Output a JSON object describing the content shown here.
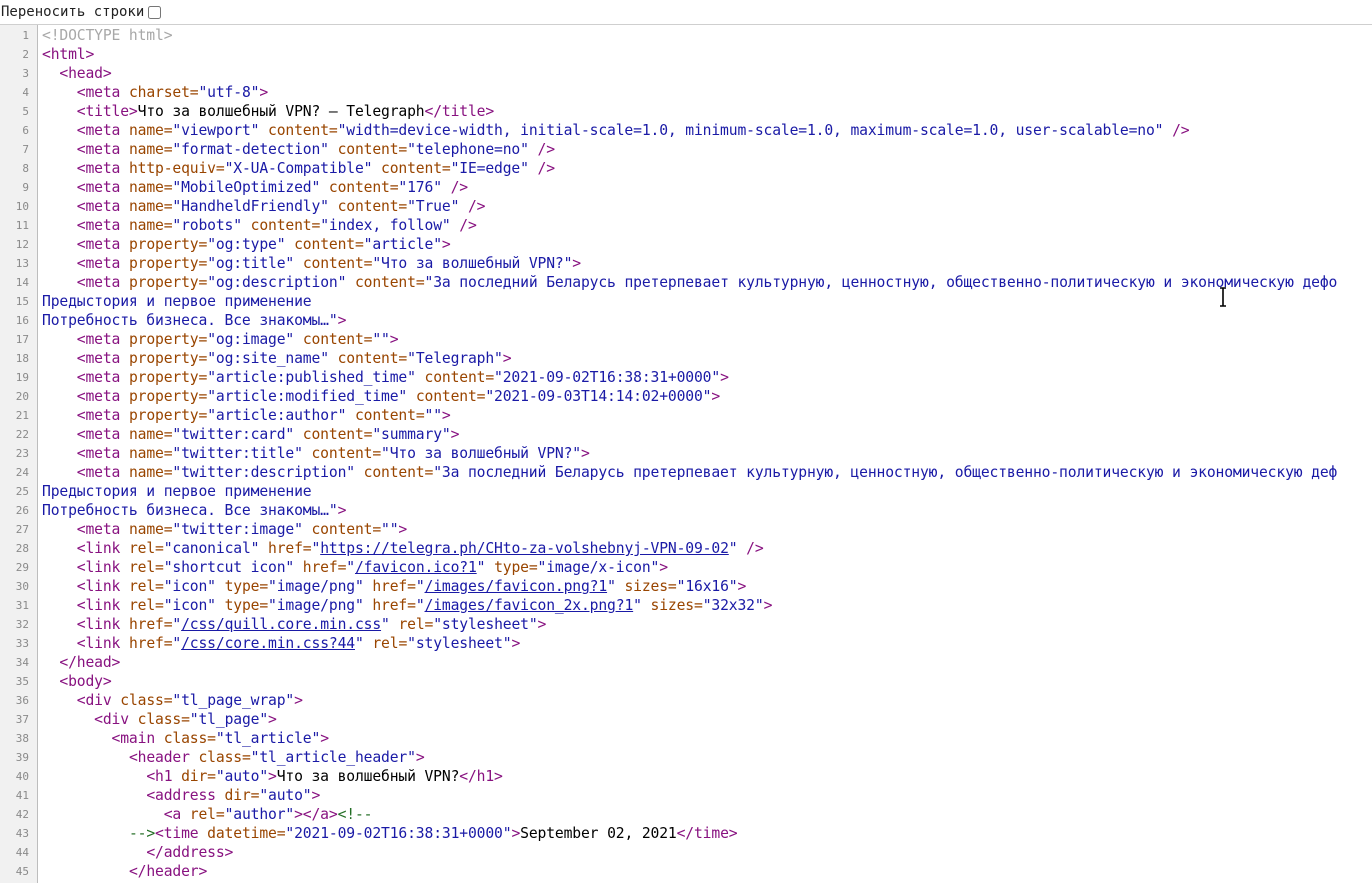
{
  "toolbar": {
    "wrap_label": "Переносить строки",
    "wrap_checked": false
  },
  "lines": [
    [
      [
        "d",
        "<!DOCTYPE html>"
      ]
    ],
    [
      [
        "t",
        "<html>"
      ]
    ],
    [
      [
        "x",
        "  "
      ],
      [
        "t",
        "<head>"
      ]
    ],
    [
      [
        "x",
        "    "
      ],
      [
        "t",
        "<meta"
      ],
      [
        "a",
        " charset="
      ],
      [
        "v",
        "\"utf-8\""
      ],
      [
        "t",
        ">"
      ]
    ],
    [
      [
        "x",
        "    "
      ],
      [
        "t",
        "<title>"
      ],
      [
        "x",
        "Что за волшебный VPN? – Telegraph"
      ],
      [
        "t",
        "</title>"
      ]
    ],
    [
      [
        "x",
        "    "
      ],
      [
        "t",
        "<meta"
      ],
      [
        "a",
        " name="
      ],
      [
        "v",
        "\"viewport\""
      ],
      [
        "a",
        " content="
      ],
      [
        "v",
        "\"width=device-width, initial-scale=1.0, minimum-scale=1.0, maximum-scale=1.0, user-scalable=no\""
      ],
      [
        "t",
        " />"
      ]
    ],
    [
      [
        "x",
        "    "
      ],
      [
        "t",
        "<meta"
      ],
      [
        "a",
        " name="
      ],
      [
        "v",
        "\"format-detection\""
      ],
      [
        "a",
        " content="
      ],
      [
        "v",
        "\"telephone=no\""
      ],
      [
        "t",
        " />"
      ]
    ],
    [
      [
        "x",
        "    "
      ],
      [
        "t",
        "<meta"
      ],
      [
        "a",
        " http-equiv="
      ],
      [
        "v",
        "\"X-UA-Compatible\""
      ],
      [
        "a",
        " content="
      ],
      [
        "v",
        "\"IE=edge\""
      ],
      [
        "t",
        " />"
      ]
    ],
    [
      [
        "x",
        "    "
      ],
      [
        "t",
        "<meta"
      ],
      [
        "a",
        " name="
      ],
      [
        "v",
        "\"MobileOptimized\""
      ],
      [
        "a",
        " content="
      ],
      [
        "v",
        "\"176\""
      ],
      [
        "t",
        " />"
      ]
    ],
    [
      [
        "x",
        "    "
      ],
      [
        "t",
        "<meta"
      ],
      [
        "a",
        " name="
      ],
      [
        "v",
        "\"HandheldFriendly\""
      ],
      [
        "a",
        " content="
      ],
      [
        "v",
        "\"True\""
      ],
      [
        "t",
        " />"
      ]
    ],
    [
      [
        "x",
        "    "
      ],
      [
        "t",
        "<meta"
      ],
      [
        "a",
        " name="
      ],
      [
        "v",
        "\"robots\""
      ],
      [
        "a",
        " content="
      ],
      [
        "v",
        "\"index, follow\""
      ],
      [
        "t",
        " />"
      ]
    ],
    [
      [
        "x",
        "    "
      ],
      [
        "t",
        "<meta"
      ],
      [
        "a",
        " property="
      ],
      [
        "v",
        "\"og:type\""
      ],
      [
        "a",
        " content="
      ],
      [
        "v",
        "\"article\""
      ],
      [
        "t",
        ">"
      ]
    ],
    [
      [
        "x",
        "    "
      ],
      [
        "t",
        "<meta"
      ],
      [
        "a",
        " property="
      ],
      [
        "v",
        "\"og:title\""
      ],
      [
        "a",
        " content="
      ],
      [
        "v",
        "\"Что за волшебный VPN?\""
      ],
      [
        "t",
        ">"
      ]
    ],
    [
      [
        "x",
        "    "
      ],
      [
        "t",
        "<meta"
      ],
      [
        "a",
        " property="
      ],
      [
        "v",
        "\"og:description\""
      ],
      [
        "a",
        " content="
      ],
      [
        "v",
        "\"За последний Беларусь претерпевает культурную, ценностную, общественно-политическую и экономическую дефо"
      ]
    ],
    [
      [
        "v",
        "Предыстория и первое применение"
      ]
    ],
    [
      [
        "v",
        "Потребность бизнеса. Все знакомы…\""
      ],
      [
        "t",
        ">"
      ]
    ],
    [
      [
        "x",
        "    "
      ],
      [
        "t",
        "<meta"
      ],
      [
        "a",
        " property="
      ],
      [
        "v",
        "\"og:image\""
      ],
      [
        "a",
        " content="
      ],
      [
        "v",
        "\"\""
      ],
      [
        "t",
        ">"
      ]
    ],
    [
      [
        "x",
        "    "
      ],
      [
        "t",
        "<meta"
      ],
      [
        "a",
        " property="
      ],
      [
        "v",
        "\"og:site_name\""
      ],
      [
        "a",
        " content="
      ],
      [
        "v",
        "\"Telegraph\""
      ],
      [
        "t",
        ">"
      ]
    ],
    [
      [
        "x",
        "    "
      ],
      [
        "t",
        "<meta"
      ],
      [
        "a",
        " property="
      ],
      [
        "v",
        "\"article:published_time\""
      ],
      [
        "a",
        " content="
      ],
      [
        "v",
        "\"2021-09-02T16:38:31+0000\""
      ],
      [
        "t",
        ">"
      ]
    ],
    [
      [
        "x",
        "    "
      ],
      [
        "t",
        "<meta"
      ],
      [
        "a",
        " property="
      ],
      [
        "v",
        "\"article:modified_time\""
      ],
      [
        "a",
        " content="
      ],
      [
        "v",
        "\"2021-09-03T14:14:02+0000\""
      ],
      [
        "t",
        ">"
      ]
    ],
    [
      [
        "x",
        "    "
      ],
      [
        "t",
        "<meta"
      ],
      [
        "a",
        " property="
      ],
      [
        "v",
        "\"article:author\""
      ],
      [
        "a",
        " content="
      ],
      [
        "v",
        "\"\""
      ],
      [
        "t",
        ">"
      ]
    ],
    [
      [
        "x",
        "    "
      ],
      [
        "t",
        "<meta"
      ],
      [
        "a",
        " name="
      ],
      [
        "v",
        "\"twitter:card\""
      ],
      [
        "a",
        " content="
      ],
      [
        "v",
        "\"summary\""
      ],
      [
        "t",
        ">"
      ]
    ],
    [
      [
        "x",
        "    "
      ],
      [
        "t",
        "<meta"
      ],
      [
        "a",
        " name="
      ],
      [
        "v",
        "\"twitter:title\""
      ],
      [
        "a",
        " content="
      ],
      [
        "v",
        "\"Что за волшебный VPN?\""
      ],
      [
        "t",
        ">"
      ]
    ],
    [
      [
        "x",
        "    "
      ],
      [
        "t",
        "<meta"
      ],
      [
        "a",
        " name="
      ],
      [
        "v",
        "\"twitter:description\""
      ],
      [
        "a",
        " content="
      ],
      [
        "v",
        "\"За последний Беларусь претерпевает культурную, ценностную, общественно-политическую и экономическую деф"
      ]
    ],
    [
      [
        "v",
        "Предыстория и первое применение"
      ]
    ],
    [
      [
        "v",
        "Потребность бизнеса. Все знакомы…\""
      ],
      [
        "t",
        ">"
      ]
    ],
    [
      [
        "x",
        "    "
      ],
      [
        "t",
        "<meta"
      ],
      [
        "a",
        " name="
      ],
      [
        "v",
        "\"twitter:image\""
      ],
      [
        "a",
        " content="
      ],
      [
        "v",
        "\"\""
      ],
      [
        "t",
        ">"
      ]
    ],
    [
      [
        "x",
        "    "
      ],
      [
        "t",
        "<link"
      ],
      [
        "a",
        " rel="
      ],
      [
        "v",
        "\"canonical\""
      ],
      [
        "a",
        " href="
      ],
      [
        "v",
        "\""
      ],
      [
        "l",
        "https://telegra.ph/CHto-za-volshebnyj-VPN-09-02"
      ],
      [
        "v",
        "\""
      ],
      [
        "t",
        " />"
      ]
    ],
    [
      [
        "x",
        "    "
      ],
      [
        "t",
        "<link"
      ],
      [
        "a",
        " rel="
      ],
      [
        "v",
        "\"shortcut icon\""
      ],
      [
        "a",
        " href="
      ],
      [
        "v",
        "\""
      ],
      [
        "l",
        "/favicon.ico?1"
      ],
      [
        "v",
        "\""
      ],
      [
        "a",
        " type="
      ],
      [
        "v",
        "\"image/x-icon\""
      ],
      [
        "t",
        ">"
      ]
    ],
    [
      [
        "x",
        "    "
      ],
      [
        "t",
        "<link"
      ],
      [
        "a",
        " rel="
      ],
      [
        "v",
        "\"icon\""
      ],
      [
        "a",
        " type="
      ],
      [
        "v",
        "\"image/png\""
      ],
      [
        "a",
        " href="
      ],
      [
        "v",
        "\""
      ],
      [
        "l",
        "/images/favicon.png?1"
      ],
      [
        "v",
        "\""
      ],
      [
        "a",
        " sizes="
      ],
      [
        "v",
        "\"16x16\""
      ],
      [
        "t",
        ">"
      ]
    ],
    [
      [
        "x",
        "    "
      ],
      [
        "t",
        "<link"
      ],
      [
        "a",
        " rel="
      ],
      [
        "v",
        "\"icon\""
      ],
      [
        "a",
        " type="
      ],
      [
        "v",
        "\"image/png\""
      ],
      [
        "a",
        " href="
      ],
      [
        "v",
        "\""
      ],
      [
        "l",
        "/images/favicon_2x.png?1"
      ],
      [
        "v",
        "\""
      ],
      [
        "a",
        " sizes="
      ],
      [
        "v",
        "\"32x32\""
      ],
      [
        "t",
        ">"
      ]
    ],
    [
      [
        "x",
        "    "
      ],
      [
        "t",
        "<link"
      ],
      [
        "a",
        " href="
      ],
      [
        "v",
        "\""
      ],
      [
        "l",
        "/css/quill.core.min.css"
      ],
      [
        "v",
        "\""
      ],
      [
        "a",
        " rel="
      ],
      [
        "v",
        "\"stylesheet\""
      ],
      [
        "t",
        ">"
      ]
    ],
    [
      [
        "x",
        "    "
      ],
      [
        "t",
        "<link"
      ],
      [
        "a",
        " href="
      ],
      [
        "v",
        "\""
      ],
      [
        "l",
        "/css/core.min.css?44"
      ],
      [
        "v",
        "\""
      ],
      [
        "a",
        " rel="
      ],
      [
        "v",
        "\"stylesheet\""
      ],
      [
        "t",
        ">"
      ]
    ],
    [
      [
        "x",
        "  "
      ],
      [
        "t",
        "</head>"
      ]
    ],
    [
      [
        "x",
        "  "
      ],
      [
        "t",
        "<body>"
      ]
    ],
    [
      [
        "x",
        "    "
      ],
      [
        "t",
        "<div"
      ],
      [
        "a",
        " class="
      ],
      [
        "v",
        "\"tl_page_wrap\""
      ],
      [
        "t",
        ">"
      ]
    ],
    [
      [
        "x",
        "      "
      ],
      [
        "t",
        "<div"
      ],
      [
        "a",
        " class="
      ],
      [
        "v",
        "\"tl_page\""
      ],
      [
        "t",
        ">"
      ]
    ],
    [
      [
        "x",
        "        "
      ],
      [
        "t",
        "<main"
      ],
      [
        "a",
        " class="
      ],
      [
        "v",
        "\"tl_article\""
      ],
      [
        "t",
        ">"
      ]
    ],
    [
      [
        "x",
        "          "
      ],
      [
        "t",
        "<header"
      ],
      [
        "a",
        " class="
      ],
      [
        "v",
        "\"tl_article_header\""
      ],
      [
        "t",
        ">"
      ]
    ],
    [
      [
        "x",
        "            "
      ],
      [
        "t",
        "<h1"
      ],
      [
        "a",
        " dir="
      ],
      [
        "v",
        "\"auto\""
      ],
      [
        "t",
        ">"
      ],
      [
        "x",
        "Что за волшебный VPN?"
      ],
      [
        "t",
        "</h1>"
      ]
    ],
    [
      [
        "x",
        "            "
      ],
      [
        "t",
        "<address"
      ],
      [
        "a",
        " dir="
      ],
      [
        "v",
        "\"auto\""
      ],
      [
        "t",
        ">"
      ]
    ],
    [
      [
        "x",
        "              "
      ],
      [
        "t",
        "<a"
      ],
      [
        "a",
        " rel="
      ],
      [
        "v",
        "\"author\""
      ],
      [
        "t",
        "></a>"
      ],
      [
        "c",
        "<!--"
      ]
    ],
    [
      [
        "x",
        "          "
      ],
      [
        "c",
        "-->"
      ],
      [
        "t",
        "<time"
      ],
      [
        "a",
        " datetime="
      ],
      [
        "v",
        "\"2021-09-02T16:38:31+0000\""
      ],
      [
        "t",
        ">"
      ],
      [
        "x",
        "September 02, 2021"
      ],
      [
        "t",
        "</time>"
      ]
    ],
    [
      [
        "x",
        "            "
      ],
      [
        "t",
        "</address>"
      ]
    ],
    [
      [
        "x",
        "          "
      ],
      [
        "t",
        "</header>"
      ]
    ]
  ]
}
